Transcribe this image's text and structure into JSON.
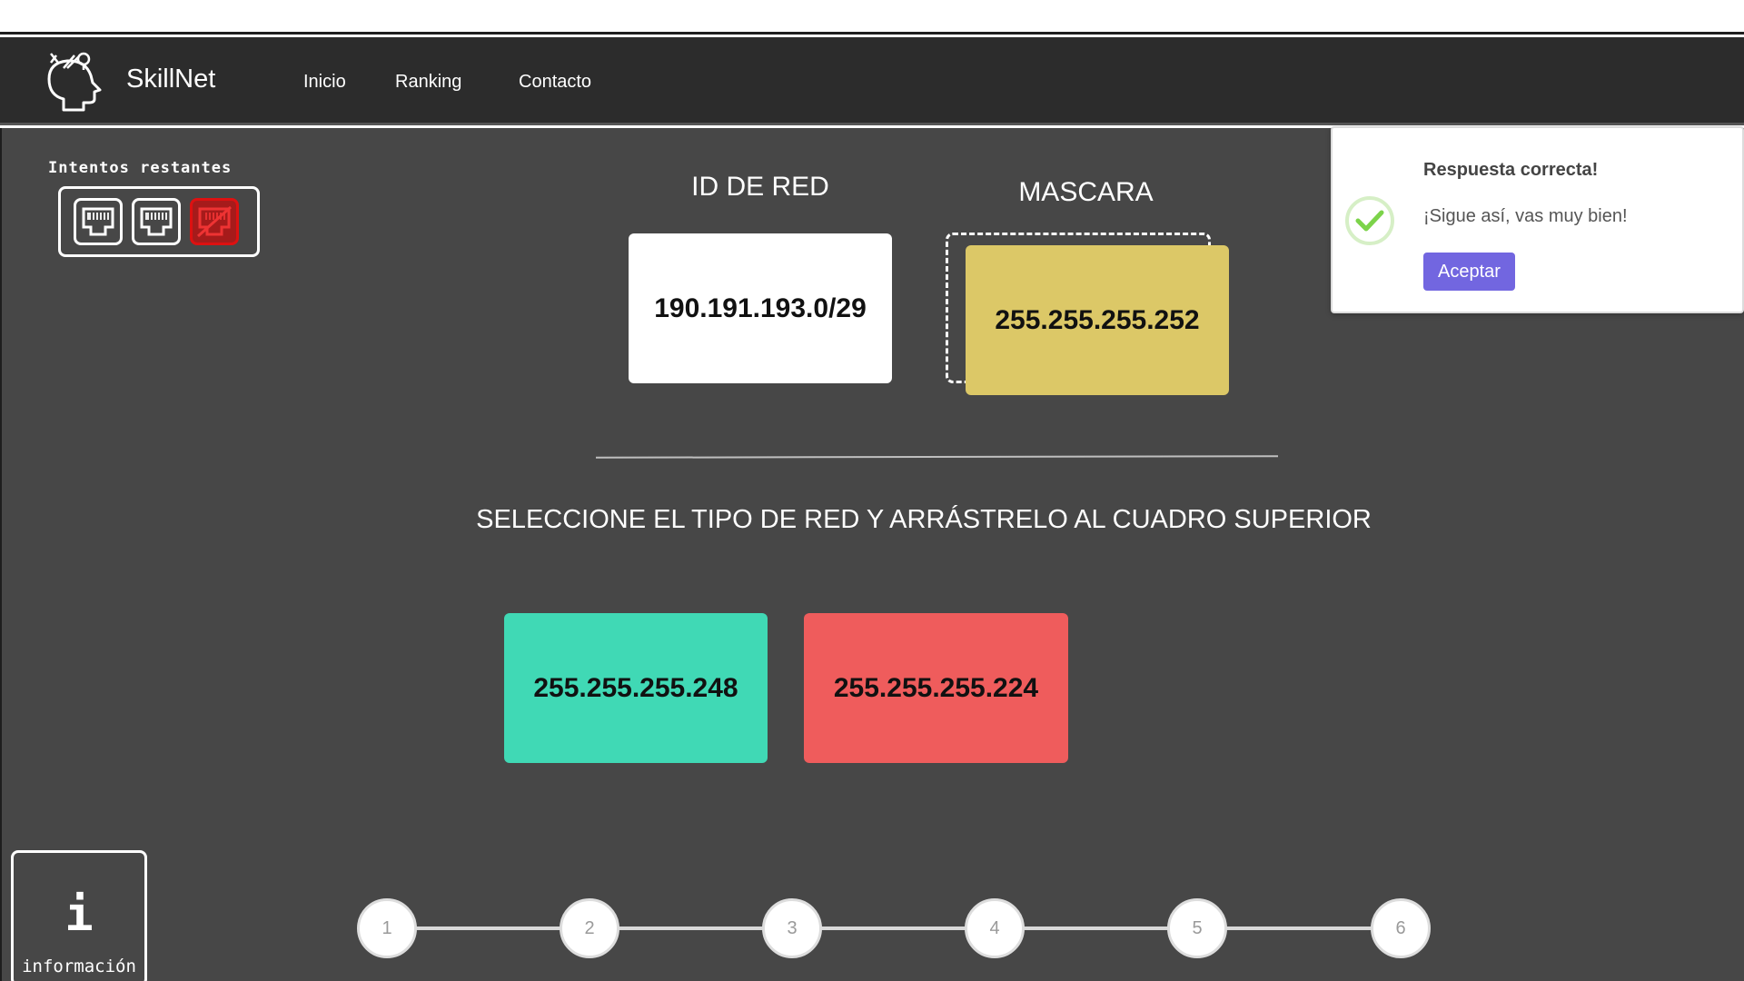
{
  "app": {
    "brand": "SkillNet",
    "nav": [
      "Inicio",
      "Ranking",
      "Contacto"
    ]
  },
  "attempts": {
    "label": "Intentos restantes",
    "total": 3,
    "remaining": 2
  },
  "exercise": {
    "id_title": "ID DE RED",
    "id_value": "190.191.193.0/29",
    "mask_title": "MASCARA",
    "mask_value": "255.255.255.252",
    "instruction": "SELECCIONE EL TIPO DE RED Y ARRÁSTRELO AL CUADRO SUPERIOR",
    "options": [
      "255.255.255.248",
      "255.255.255.224"
    ]
  },
  "info_button": {
    "icon": "i",
    "label": "información"
  },
  "progress": {
    "steps": [
      "1",
      "2",
      "3",
      "4",
      "5",
      "6"
    ]
  },
  "toast": {
    "title": "Respuesta correcta!",
    "message": "¡Sigue así, vas muy bien!",
    "accept_label": "Aceptar"
  },
  "colors": {
    "mask_card": "#dcc867",
    "option_1": "#40d9b5",
    "option_2": "#ef5c5c",
    "accept_button": "#7266e0",
    "success_check": "#7cd34a"
  }
}
